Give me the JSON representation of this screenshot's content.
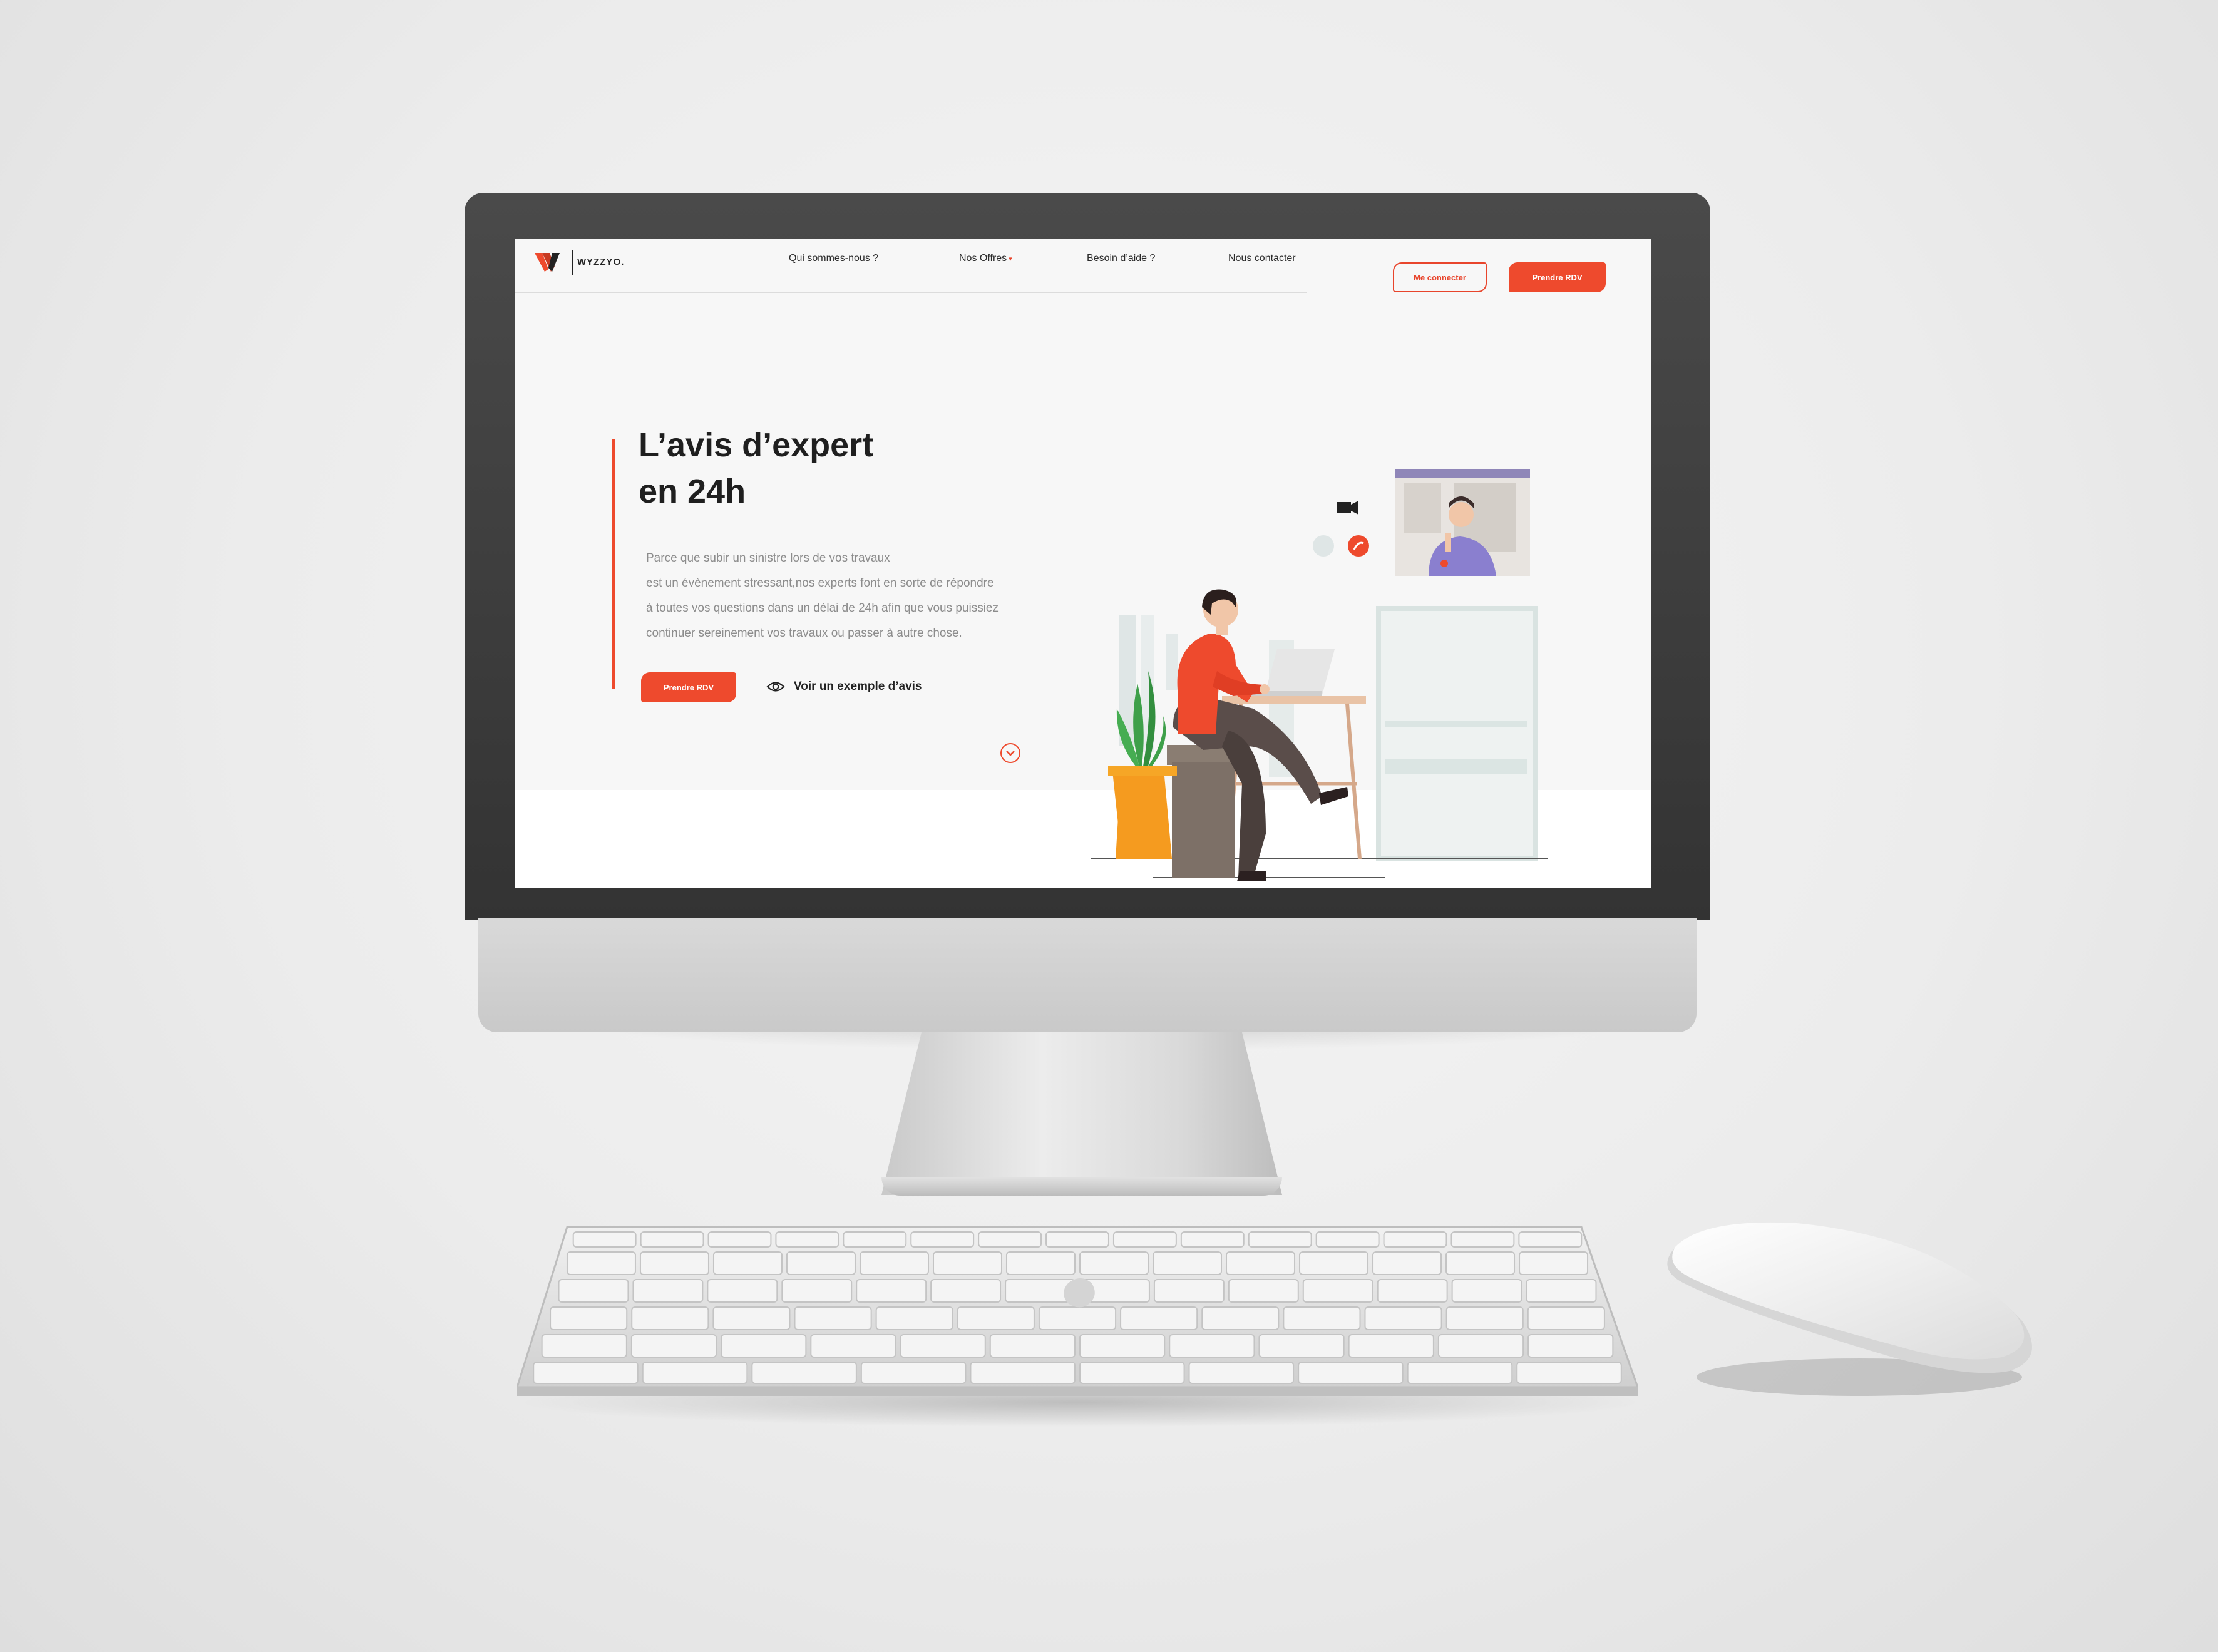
{
  "brand": {
    "name": "WYZZYO."
  },
  "nav": {
    "items": [
      {
        "label": "Qui sommes-nous ?"
      },
      {
        "label": "Nos Offres",
        "caret": "▾"
      },
      {
        "label": "Besoin d’aide ?"
      },
      {
        "label": "Nous contacter"
      }
    ]
  },
  "header": {
    "login_label": "Me connecter",
    "rdv_label": "Prendre RDV"
  },
  "hero": {
    "title_line1": "L’avis d’expert",
    "title_line2": "en 24h",
    "description": [
      "Parce que subir un sinistre lors de vos travaux",
      "est un évènement stressant,nos experts font en sorte de répondre",
      "à toutes vos questions dans un délai de 24h afin que vous puissiez",
      "continuer sereinement vos travaux ou passer à autre chose."
    ],
    "rdv_label": "Prendre RDV",
    "example_label": "Voir un exemple d’avis"
  },
  "icons": {
    "logo": "wyzzyo-logo-icon",
    "eye": "eye-icon",
    "scroll": "chevron-down-icon",
    "video": "video-camera-icon",
    "mute": "microphone-icon",
    "hangup": "phone-icon"
  },
  "colors": {
    "accent": "#ee4a2d",
    "text_dark": "#1f1f1f",
    "text_muted": "#8c8c8c",
    "screen_bg": "#f7f7f7"
  }
}
